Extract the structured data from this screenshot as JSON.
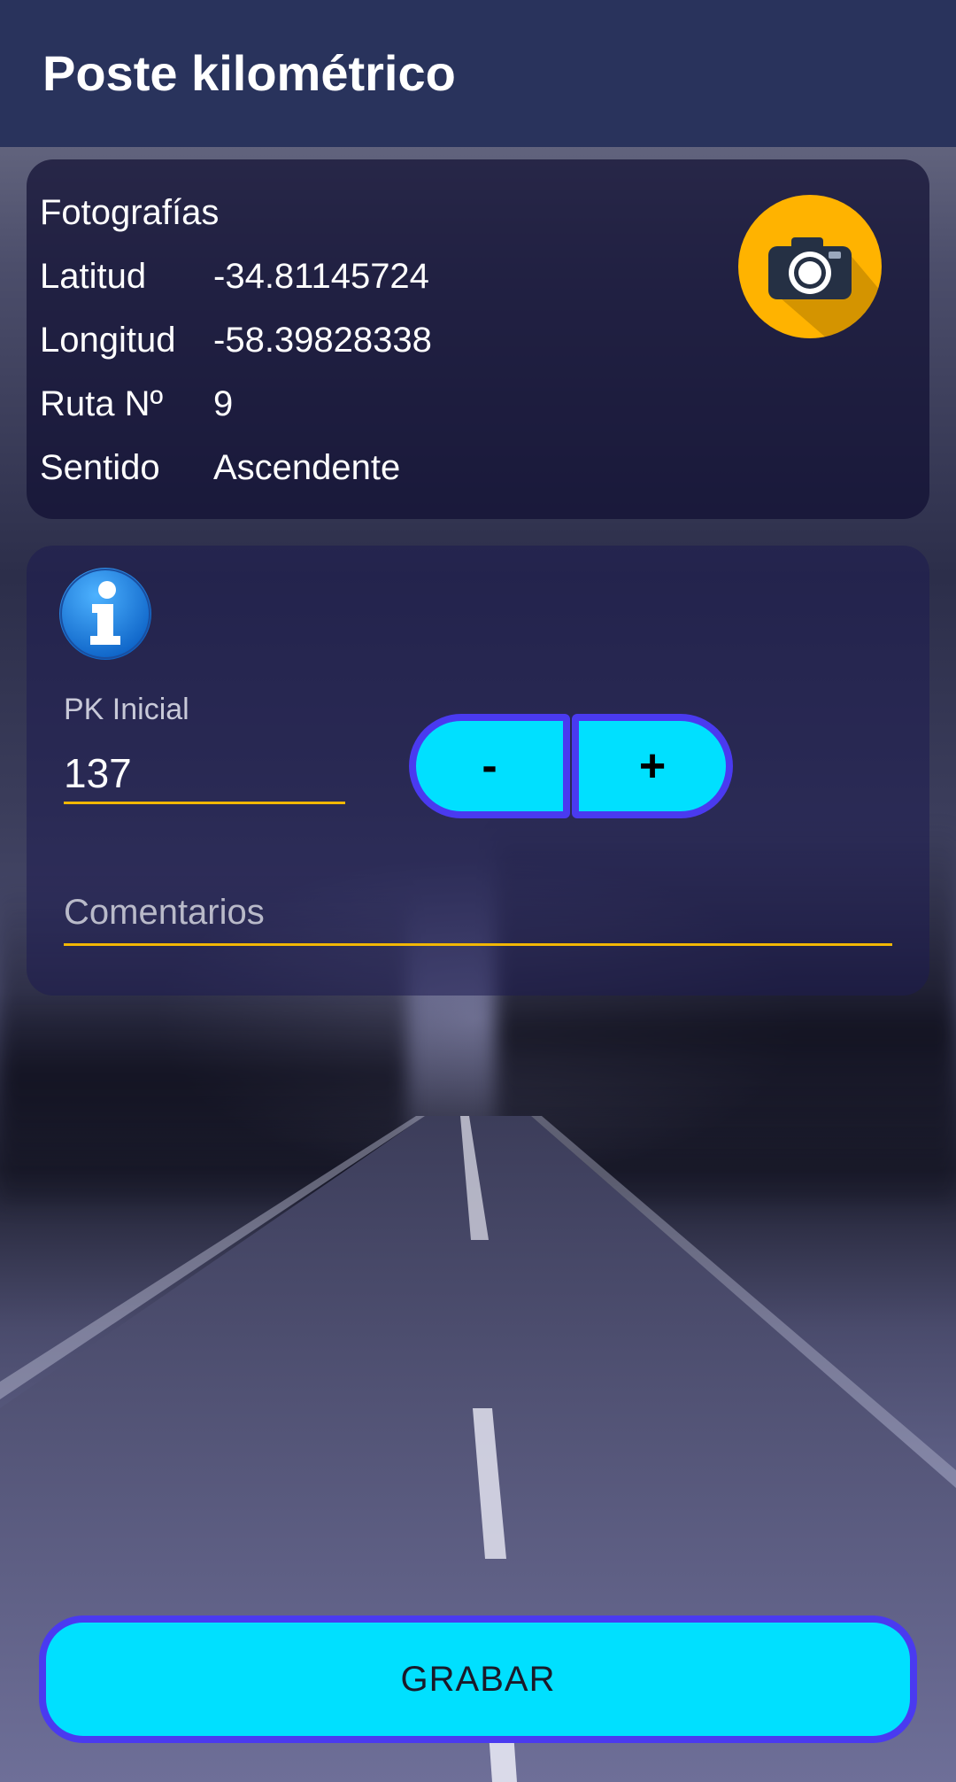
{
  "app_bar": {
    "title": "Poste kilométrico"
  },
  "photos_card": {
    "title": "Fotografías",
    "camera_icon": "camera-icon",
    "rows": [
      {
        "label": "Latitud",
        "value": "-34.81145724"
      },
      {
        "label": "Longitud",
        "value": "-58.39828338"
      },
      {
        "label": "Ruta Nº",
        "value": "9"
      },
      {
        "label": "Sentido",
        "value": "Ascendente"
      }
    ]
  },
  "form_card": {
    "info_icon": "info-icon",
    "pk_label": "PK Inicial",
    "pk_value": "137",
    "minus_label": "-",
    "plus_label": "+",
    "comments_placeholder": "Comentarios"
  },
  "save_button": {
    "label": "GRABAR"
  },
  "colors": {
    "app_bar": "#29335c",
    "accent_cyan": "#00e0ff",
    "button_border": "#4a3af0",
    "underline": "#f2b705",
    "camera_bg": "#ffb300"
  }
}
